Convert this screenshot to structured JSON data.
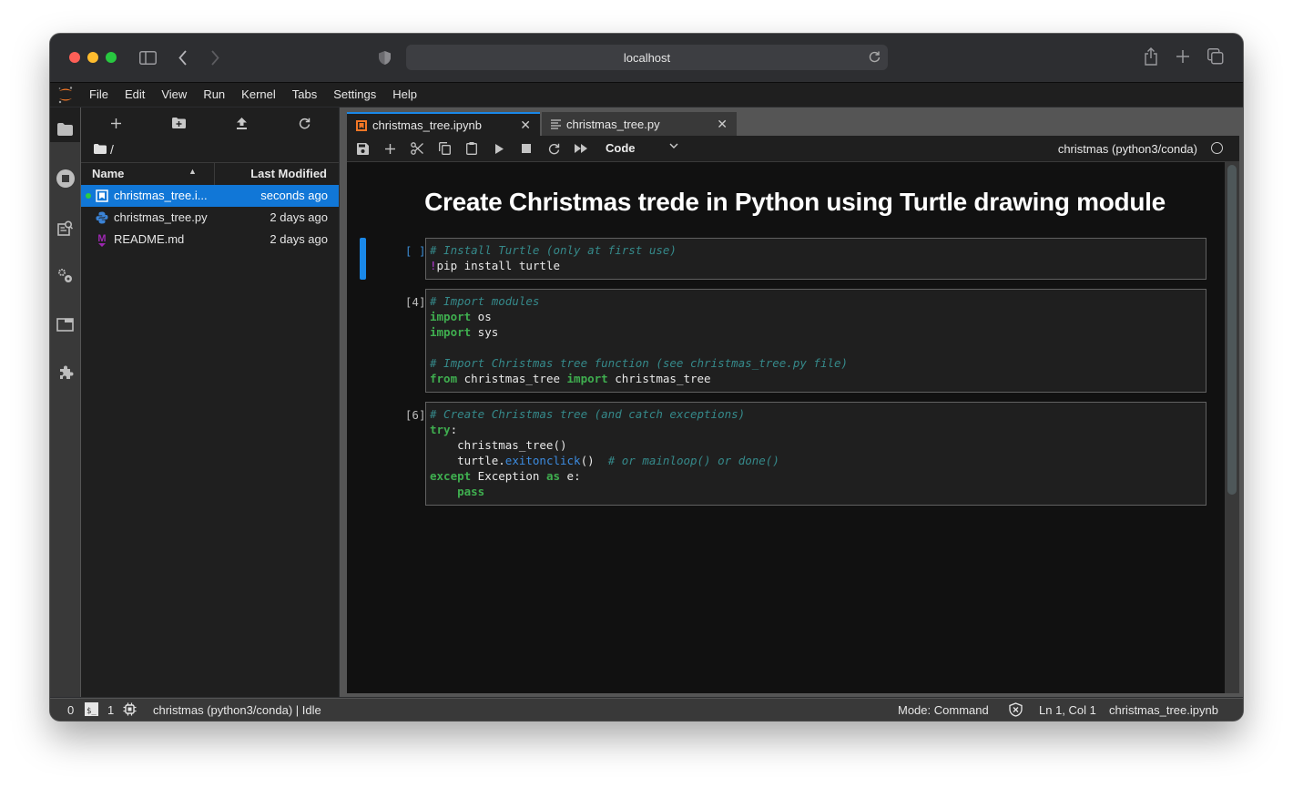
{
  "browser": {
    "url": "localhost",
    "traffic_lights": {
      "close": "#fe5f57",
      "minimize": "#febc2e",
      "maximize": "#28c840"
    },
    "icons": [
      "sidebar-icon",
      "back-icon",
      "forward-icon",
      "shield-icon",
      "reload-icon",
      "share-icon",
      "new-tab-icon",
      "tabs-overview-icon"
    ]
  },
  "menubar": {
    "items": [
      "File",
      "Edit",
      "View",
      "Run",
      "Kernel",
      "Tabs",
      "Settings",
      "Help"
    ]
  },
  "activity_bar": {
    "items": [
      "file-browser",
      "running-terminals-kernels",
      "property-inspector",
      "extension-settings",
      "tabs-list",
      "extension-manager"
    ]
  },
  "file_browser": {
    "path": "/",
    "columns": {
      "name": "Name",
      "last_modified": "Last Modified"
    },
    "files": [
      {
        "name": "christmas_tree.i...",
        "modified": "seconds ago",
        "type": "notebook",
        "selected": true,
        "running": true
      },
      {
        "name": "christmas_tree.py",
        "modified": "2 days ago",
        "type": "python",
        "selected": false,
        "running": false
      },
      {
        "name": "README.md",
        "modified": "2 days ago",
        "type": "markdown",
        "selected": false,
        "running": false
      }
    ]
  },
  "tabs": [
    {
      "label": "christmas_tree.ipynb",
      "active": true,
      "icon": "notebook-icon"
    },
    {
      "label": "christmas_tree.py",
      "active": false,
      "icon": "text-file-icon"
    }
  ],
  "notebook_toolbar": {
    "cell_type": "Code",
    "kernel": "christmas (python3/conda)"
  },
  "notebook": {
    "heading": "Create Christmas trede in Python using Turtle drawing module",
    "cells": [
      {
        "prompt": "[ ]:",
        "active": true,
        "lines": [
          [
            {
              "t": "# Install Turtle (only at first use)",
              "c": "com"
            }
          ],
          [
            {
              "t": "!",
              "c": "magic"
            },
            {
              "t": "pip install turtle",
              "c": ""
            }
          ]
        ]
      },
      {
        "prompt": "[4]:",
        "active": false,
        "lines": [
          [
            {
              "t": "# Import modules",
              "c": "com"
            }
          ],
          [
            {
              "t": "import",
              "c": "kw"
            },
            {
              "t": " os",
              "c": ""
            }
          ],
          [
            {
              "t": "import",
              "c": "kw"
            },
            {
              "t": " sys",
              "c": ""
            }
          ],
          [
            {
              "t": "",
              "c": ""
            }
          ],
          [
            {
              "t": "# Import Christmas tree function (see christmas_tree.py file)",
              "c": "com"
            }
          ],
          [
            {
              "t": "from",
              "c": "kw"
            },
            {
              "t": " christmas_tree ",
              "c": ""
            },
            {
              "t": "import",
              "c": "kw"
            },
            {
              "t": " christmas_tree",
              "c": ""
            }
          ]
        ]
      },
      {
        "prompt": "[6]:",
        "active": false,
        "lines": [
          [
            {
              "t": "# Create Christmas tree (and catch exceptions)",
              "c": "com"
            }
          ],
          [
            {
              "t": "try",
              "c": "kw"
            },
            {
              "t": ":",
              "c": ""
            }
          ],
          [
            {
              "t": "    christmas_tree()",
              "c": ""
            }
          ],
          [
            {
              "t": "    turtle.",
              "c": ""
            },
            {
              "t": "exitonclick",
              "c": "fn"
            },
            {
              "t": "()  ",
              "c": ""
            },
            {
              "t": "# or mainloop() or done()",
              "c": "com"
            }
          ],
          [
            {
              "t": "except",
              "c": "kw"
            },
            {
              "t": " Exception ",
              "c": ""
            },
            {
              "t": "as",
              "c": "kw"
            },
            {
              "t": " e:",
              "c": ""
            }
          ],
          [
            {
              "t": "    ",
              "c": ""
            },
            {
              "t": "pass",
              "c": "kw"
            }
          ]
        ]
      }
    ]
  },
  "statusbar": {
    "terminals": "0",
    "kernels": "1",
    "kernel_status": "christmas (python3/conda) | Idle",
    "mode": "Mode: Command",
    "cursor": "Ln 1, Col 1",
    "filename": "christmas_tree.ipynb"
  },
  "colors": {
    "accent": "#1a88e8",
    "selection": "#1177d7",
    "comment": "#35898a",
    "keyword": "#3fae4f",
    "magic": "#b83bd6",
    "function": "#3c8bdf"
  }
}
